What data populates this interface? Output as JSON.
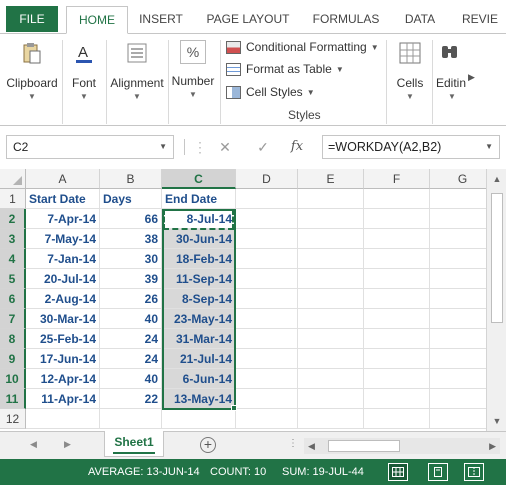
{
  "ribbon_tabs": {
    "file": "FILE",
    "home": "HOME",
    "insert": "INSERT",
    "page_layout": "PAGE LAYOUT",
    "formulas": "FORMULAS",
    "data": "DATA",
    "review": "REVIE"
  },
  "ribbon": {
    "clipboard": "Clipboard",
    "font": "Font",
    "alignment": "Alignment",
    "number": "Number",
    "conditional_formatting": "Conditional Formatting",
    "format_as_table": "Format as Table",
    "cell_styles": "Cell Styles",
    "styles_group": "Styles",
    "cells": "Cells",
    "editing": "Editin",
    "number_icon_text": "%"
  },
  "formula_bar": {
    "name_box": "C2",
    "fx": "fx",
    "formula": "=WORKDAY(A2,B2)"
  },
  "columns": [
    "A",
    "B",
    "C",
    "D",
    "E",
    "F",
    "G"
  ],
  "rows": [
    "1",
    "2",
    "3",
    "4",
    "5",
    "6",
    "7",
    "8",
    "9",
    "10",
    "11",
    "12"
  ],
  "table": {
    "headers": [
      "Start Date",
      "Days",
      "End Date"
    ],
    "data": [
      [
        "7-Apr-14",
        "66",
        "8-Jul-14"
      ],
      [
        "7-May-14",
        "38",
        "30-Jun-14"
      ],
      [
        "7-Jan-14",
        "30",
        "18-Feb-14"
      ],
      [
        "20-Jul-14",
        "39",
        "11-Sep-14"
      ],
      [
        "2-Aug-14",
        "26",
        "8-Sep-14"
      ],
      [
        "30-Mar-14",
        "40",
        "23-May-14"
      ],
      [
        "25-Feb-14",
        "24",
        "31-Mar-14"
      ],
      [
        "17-Jun-14",
        "24",
        "21-Jul-14"
      ],
      [
        "12-Apr-14",
        "40",
        "6-Jun-14"
      ],
      [
        "11-Apr-14",
        "22",
        "13-May-14"
      ]
    ]
  },
  "sheet_tab": "Sheet1",
  "status_bar": {
    "average": "AVERAGE: 13-JUN-14",
    "count": "COUNT: 10",
    "sum": "SUM: 19-JUL-44"
  },
  "colors": {
    "accent": "#217346",
    "selection": "#d8d8d8",
    "text_blue": "#1f4e8c"
  },
  "icons": [
    "paste-icon",
    "font-color-icon",
    "align-icon",
    "percent-icon",
    "conditional-formatting-icon",
    "format-table-icon",
    "cell-styles-icon",
    "cells-icon",
    "find-icon",
    "cancel-icon",
    "enter-icon",
    "fx-icon",
    "add-sheet-icon",
    "normal-view-icon",
    "page-layout-view-icon",
    "page-break-view-icon"
  ]
}
